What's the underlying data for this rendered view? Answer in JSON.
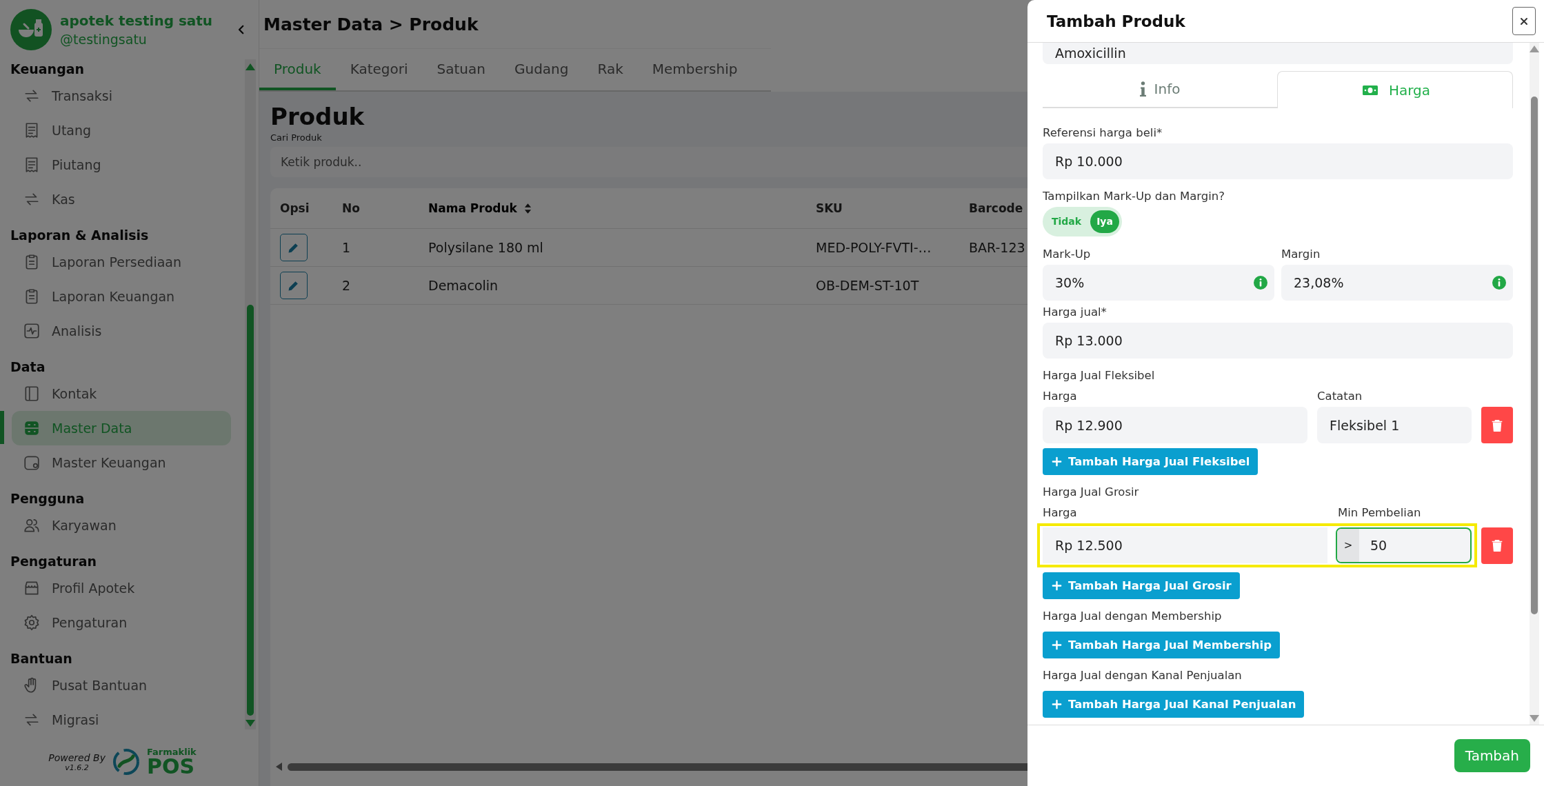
{
  "sidebar": {
    "brand": {
      "name": "apotek testing satu",
      "handle": "@testingsatu"
    },
    "sections": [
      {
        "title": "Keuangan",
        "items": [
          {
            "label": "Transaksi",
            "selected": false
          },
          {
            "label": "Utang",
            "selected": false
          },
          {
            "label": "Piutang",
            "selected": false
          },
          {
            "label": "Kas",
            "selected": false
          }
        ]
      },
      {
        "title": "Laporan & Analisis",
        "items": [
          {
            "label": "Laporan Persediaan",
            "selected": false
          },
          {
            "label": "Laporan Keuangan",
            "selected": false
          },
          {
            "label": "Analisis",
            "selected": false
          }
        ]
      },
      {
        "title": "Data",
        "items": [
          {
            "label": "Kontak",
            "selected": false
          },
          {
            "label": "Master Data",
            "selected": true
          },
          {
            "label": "Master Keuangan",
            "selected": false
          }
        ]
      },
      {
        "title": "Pengguna",
        "items": [
          {
            "label": "Karyawan",
            "selected": false
          }
        ]
      },
      {
        "title": "Pengaturan",
        "items": [
          {
            "label": "Profil Apotek",
            "selected": false
          },
          {
            "label": "Pengaturan",
            "selected": false
          }
        ]
      },
      {
        "title": "Bantuan",
        "items": [
          {
            "label": "Pusat Bantuan",
            "selected": false
          },
          {
            "label": "Migrasi",
            "selected": false
          }
        ]
      }
    ],
    "footer": {
      "powered_by": "Powered By",
      "version": "v1.6.2",
      "logo_top": "Farmaklik",
      "logo_bottom": "POS"
    }
  },
  "header": {
    "title": "Master Data > Produk"
  },
  "tabs": [
    {
      "label": "Produk",
      "selected": true
    },
    {
      "label": "Kategori",
      "selected": false
    },
    {
      "label": "Satuan",
      "selected": false
    },
    {
      "label": "Gudang",
      "selected": false
    },
    {
      "label": "Rak",
      "selected": false
    },
    {
      "label": "Membership",
      "selected": false
    }
  ],
  "page": {
    "heading": "Produk",
    "search": {
      "label": "Cari Produk",
      "placeholder": "Ketik produk.."
    },
    "table": {
      "columns": [
        {
          "label": "Opsi",
          "sortable": false
        },
        {
          "label": "No",
          "sortable": false
        },
        {
          "label": "Nama Produk",
          "sortable": true
        },
        {
          "label": "SKU",
          "sortable": false
        },
        {
          "label": "Barcode",
          "sortable": false
        }
      ],
      "rows": [
        {
          "no": "1",
          "name": "Polysilane 180 ml",
          "sku": "MED-POLY-FVTI-…",
          "barcode": "BAR-123"
        },
        {
          "no": "2",
          "name": "Demacolin",
          "sku": "OB-DEM-ST-10T"
        }
      ]
    }
  },
  "drawer": {
    "title": "Tambah Produk",
    "name_field": {
      "value": "Amoxicillin"
    },
    "tabs": [
      {
        "label": "Info",
        "selected": false
      },
      {
        "label": "Harga",
        "selected": true
      }
    ],
    "purchase_price": {
      "label": "Referensi harga beli*",
      "value": "Rp 10.000"
    },
    "markup_toggle": {
      "label": "Tampilkan Mark-Up dan Margin?",
      "options": [
        {
          "label": "Tidak",
          "selected": false
        },
        {
          "label": "Iya",
          "selected": true
        }
      ]
    },
    "markup": {
      "label": "Mark-Up",
      "value": "30%"
    },
    "margin": {
      "label": "Margin",
      "value": "23,08%"
    },
    "selling_price": {
      "label": "Harga jual*",
      "value": "Rp 13.000"
    },
    "flexible": {
      "title": "Harga Jual Fleksibel",
      "price_label": "Harga",
      "note_label": "Catatan",
      "rows": [
        {
          "price": "Rp 12.900",
          "note": "Fleksibel 1"
        }
      ],
      "add_button": "Tambah Harga Jual Fleksibel"
    },
    "wholesale": {
      "title": "Harga Jual Grosir",
      "price_label": "Harga",
      "min_label": "Min Pembelian",
      "rows": [
        {
          "price": "Rp 12.500",
          "prefix": ">",
          "min": "50",
          "highlighted": true,
          "focused": true
        }
      ],
      "add_button": "Tambah Harga Jual Grosir"
    },
    "membership": {
      "title": "Harga Jual dengan Membership",
      "add_button": "Tambah Harga Jual Membership"
    },
    "channel": {
      "title": "Harga Jual dengan Kanal Penjualan",
      "add_button": "Tambah Harga Jual Kanal Penjualan"
    },
    "submit_button": "Tambah"
  }
}
